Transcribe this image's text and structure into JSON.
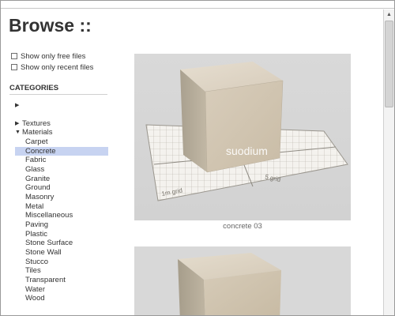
{
  "page": {
    "title": "Browse ::"
  },
  "filters": [
    {
      "label": "Show only free files",
      "checked": false
    },
    {
      "label": "Show only recent files",
      "checked": false
    }
  ],
  "categories": {
    "header": "CATEGORIES",
    "top_items": [
      {
        "label": "",
        "expanded": false
      },
      {
        "label": "Textures",
        "expanded": false
      },
      {
        "label": "Materials",
        "expanded": true
      }
    ],
    "materials": [
      "Carpet",
      "Concrete",
      "Fabric",
      "Glass",
      "Granite",
      "Ground",
      "Masonry",
      "Metal",
      "Miscellaneous",
      "Paving",
      "Plastic",
      "Stone Surface",
      "Stone Wall",
      "Stucco",
      "Tiles",
      "Transparent",
      "Water",
      "Wood"
    ],
    "selected": "Concrete"
  },
  "previews": [
    {
      "caption": "concrete 03",
      "grid_labels": [
        "1m grid",
        "5 grid"
      ],
      "logo": "suodium"
    },
    {
      "caption": ""
    }
  ]
}
